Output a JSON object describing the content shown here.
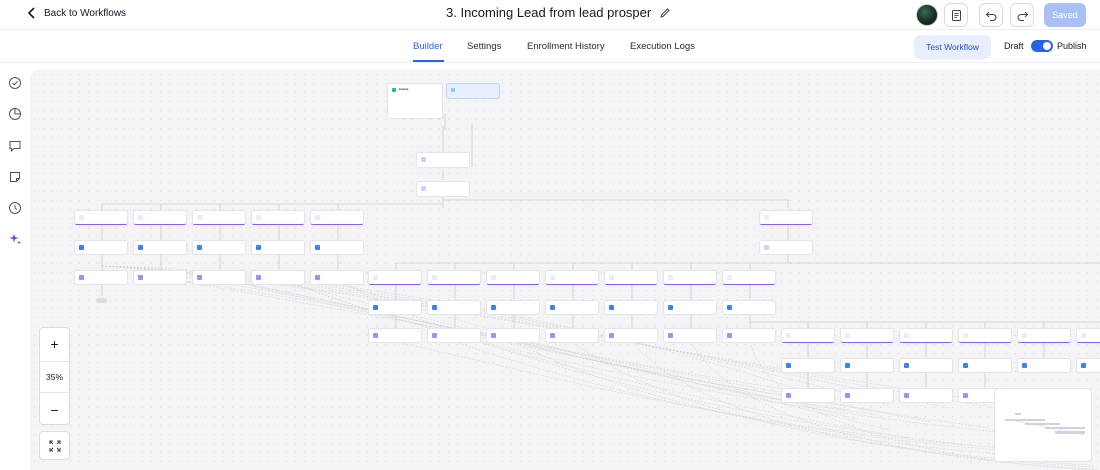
{
  "header": {
    "back_label": "Back to Workflows",
    "title": "3. Incoming Lead from lead prosper",
    "saved_label": "Saved",
    "icons": [
      "back-arrow-icon",
      "edit-pencil-icon",
      "notes-icon",
      "undo-icon",
      "redo-icon"
    ]
  },
  "tabs": [
    {
      "label": "Builder",
      "active": true
    },
    {
      "label": "Settings",
      "active": false
    },
    {
      "label": "Enrollment History",
      "active": false
    },
    {
      "label": "Execution Logs",
      "active": false
    }
  ],
  "actions": {
    "test_label": "Test Workflow",
    "draft_label": "Draft",
    "publish_label": "Publish",
    "published": true
  },
  "sidebar": {
    "icons": [
      "check-circle-icon",
      "pie-chart-icon",
      "chat-bubble-icon",
      "note-icon",
      "history-icon",
      "sparkles-icon"
    ]
  },
  "zoom": {
    "plus": "+",
    "level": "35%",
    "minus": "−"
  },
  "colors": {
    "accent": "#2563eb",
    "branch": "#8b5cf6",
    "saved_bg": "#a9c0f7",
    "canvas_bg": "#f4f4f7"
  }
}
